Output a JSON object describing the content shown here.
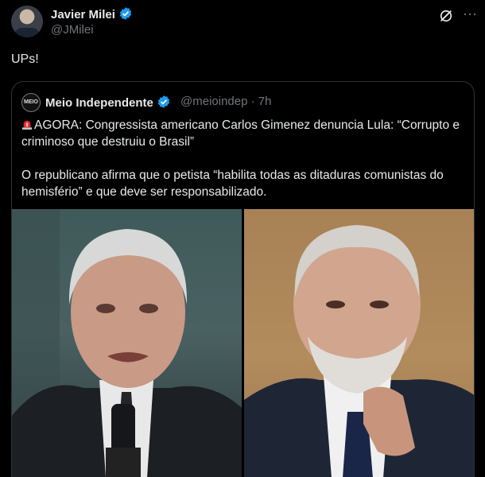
{
  "tweet": {
    "author_name": "Javier Milei",
    "author_handle": "@JMilei",
    "text": "UPs!"
  },
  "quoted": {
    "avatar_text": "MEIO",
    "author_name": "Meio Independente",
    "handle_time": "@meioindep · 7h",
    "paragraph1": "AGORA: Congressista americano Carlos Gimenez denuncia Lula: “Corrupto e criminoso que destruiu o Brasil”",
    "paragraph2": "O republicano afirma que o petista “habilita todas as ditaduras comunistas do hemisfério” e que deve ser responsabilizado."
  },
  "icons": {
    "verified": "verified-badge-icon",
    "grok": "grok-icon",
    "more": "more-icon",
    "siren": "siren-emoji-icon"
  },
  "colors": {
    "background": "#000000",
    "text": "#e7e9ea",
    "muted": "#71767b",
    "verified": "#1d9bf0",
    "border": "#2f3336"
  }
}
